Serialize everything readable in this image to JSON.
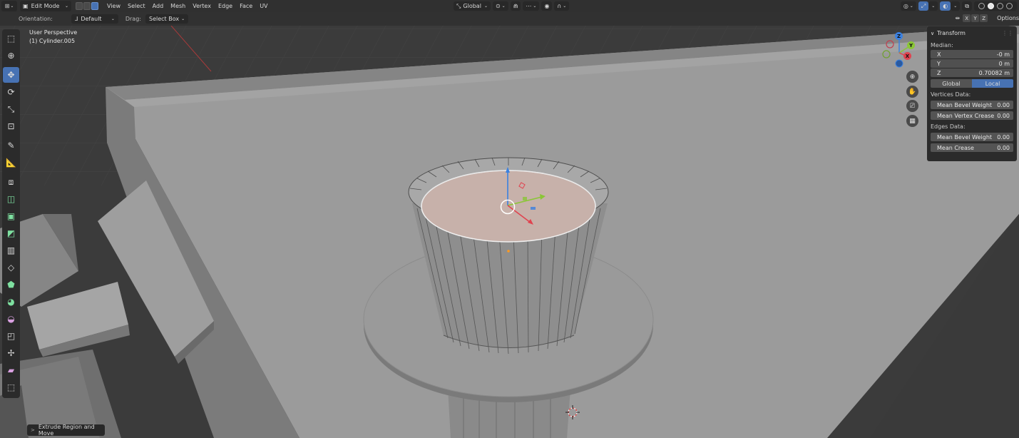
{
  "header": {
    "editor_type_icon": "3d-viewport-icon",
    "mode": "Edit Mode",
    "menus": [
      "View",
      "Select",
      "Add",
      "Mesh",
      "Vertex",
      "Edge",
      "Face",
      "UV"
    ],
    "transform_orientation": "Global",
    "options_label": "Options",
    "axis_x": "X",
    "axis_y": "Y",
    "axis_z": "Z"
  },
  "tool_settings": {
    "orientation_label": "Orientation:",
    "orientation_value": "Default",
    "drag_label": "Drag:",
    "drag_value": "Select Box"
  },
  "viewport": {
    "view_name": "User Perspective",
    "object_name": "(1) Cylinder.005",
    "gizmo": {
      "x": "X",
      "y": "Y",
      "z": "Z"
    }
  },
  "toolbar": {
    "tools": [
      "select-box-icon",
      "cursor-icon",
      "move-icon",
      "rotate-icon",
      "scale-icon",
      "transform-icon",
      "annotate-icon",
      "measure-icon",
      "add-cube-icon",
      "extrude-region-icon",
      "inset-faces-icon",
      "bevel-icon",
      "loop-cut-icon",
      "knife-icon",
      "poly-build-icon",
      "spin-icon",
      "smooth-icon",
      "edge-slide-icon",
      "shrink-fatten-icon",
      "shear-icon",
      "rip-region-icon"
    ],
    "active_tool": "move-icon"
  },
  "npanel": {
    "title": "Transform",
    "median_label": "Median:",
    "x_label": "X",
    "x_value": "-0 m",
    "y_label": "Y",
    "y_value": "0 m",
    "z_label": "Z",
    "z_value": "0.70082 m",
    "global_label": "Global",
    "local_label": "Local",
    "active_space": "Local",
    "vertices_label": "Vertices Data:",
    "v_bevel_label": "Mean Bevel Weight",
    "v_bevel_value": "0.00",
    "v_crease_label": "Mean Vertex Crease",
    "v_crease_value": "0.00",
    "edges_label": "Edges Data:",
    "e_bevel_label": "Mean Bevel Weight",
    "e_bevel_value": "0.00",
    "e_crease_label": "Mean Crease",
    "e_crease_value": "0.00"
  },
  "last_operator": "Extrude Region and Move",
  "colors": {
    "accent": "#4772b3",
    "selected_face": "#c7b1aa",
    "axis_x": "#e0434f",
    "axis_y": "#8ac636",
    "axis_z": "#3a80e0"
  }
}
